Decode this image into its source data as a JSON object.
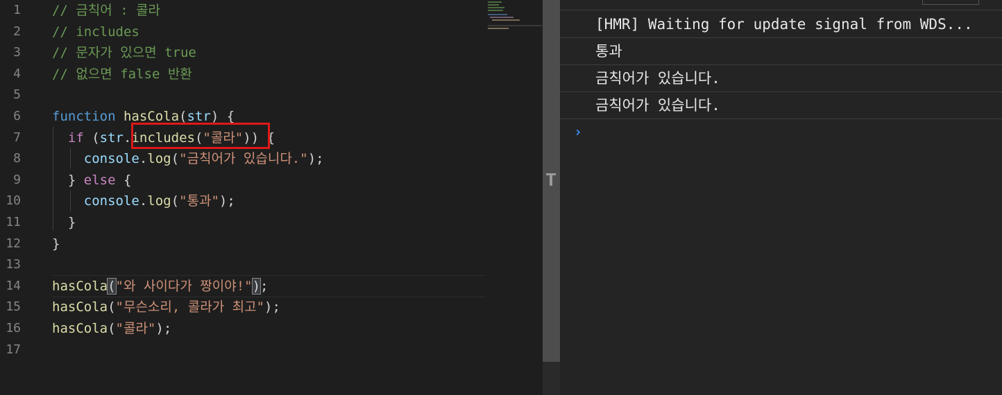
{
  "editor": {
    "lines": [
      {
        "num": "1",
        "tokens": [
          {
            "text": "// 금칙어 : 콜라",
            "type": "comment"
          }
        ]
      },
      {
        "num": "2",
        "tokens": [
          {
            "text": "// includes",
            "type": "comment"
          }
        ]
      },
      {
        "num": "3",
        "tokens": [
          {
            "text": "// 문자가 있으면 true",
            "type": "comment"
          }
        ]
      },
      {
        "num": "4",
        "tokens": [
          {
            "text": "// 없으면 false 반환",
            "type": "comment"
          }
        ]
      },
      {
        "num": "5",
        "tokens": []
      },
      {
        "num": "6",
        "tokens": [
          {
            "text": "function",
            "type": "kw"
          },
          {
            "text": " ",
            "type": "punc"
          },
          {
            "text": "hasCola",
            "type": "fn"
          },
          {
            "text": "(",
            "type": "punc"
          },
          {
            "text": "str",
            "type": "var"
          },
          {
            "text": ") {",
            "type": "punc"
          }
        ]
      },
      {
        "num": "7",
        "tokens": [
          {
            "text": "  if",
            "type": "ctrl"
          },
          {
            "text": " (",
            "type": "punc"
          },
          {
            "text": "str",
            "type": "var"
          },
          {
            "text": ".",
            "type": "punc"
          },
          {
            "text": "includes",
            "type": "fn"
          },
          {
            "text": "(",
            "type": "punc"
          },
          {
            "text": "\"콜라\"",
            "type": "str"
          },
          {
            "text": ")) {",
            "type": "punc"
          }
        ]
      },
      {
        "num": "8",
        "tokens": [
          {
            "text": "    console",
            "type": "var"
          },
          {
            "text": ".",
            "type": "punc"
          },
          {
            "text": "log",
            "type": "fn"
          },
          {
            "text": "(",
            "type": "punc"
          },
          {
            "text": "\"금칙어가 있습니다.\"",
            "type": "str"
          },
          {
            "text": ");",
            "type": "punc"
          }
        ]
      },
      {
        "num": "9",
        "tokens": [
          {
            "text": "  } ",
            "type": "punc"
          },
          {
            "text": "else",
            "type": "ctrl"
          },
          {
            "text": " {",
            "type": "punc"
          }
        ]
      },
      {
        "num": "10",
        "tokens": [
          {
            "text": "    console",
            "type": "var"
          },
          {
            "text": ".",
            "type": "punc"
          },
          {
            "text": "log",
            "type": "fn"
          },
          {
            "text": "(",
            "type": "punc"
          },
          {
            "text": "\"통과\"",
            "type": "str"
          },
          {
            "text": ");",
            "type": "punc"
          }
        ]
      },
      {
        "num": "11",
        "tokens": [
          {
            "text": "  }",
            "type": "punc"
          }
        ]
      },
      {
        "num": "12",
        "tokens": [
          {
            "text": "}",
            "type": "punc"
          }
        ]
      },
      {
        "num": "13",
        "tokens": []
      },
      {
        "num": "14",
        "tokens": [
          {
            "text": "hasCola",
            "type": "fn"
          },
          {
            "text": "(",
            "type": "punc",
            "bracket": true
          },
          {
            "text": "\"와 사이다가 짱이야!\"",
            "type": "str"
          },
          {
            "text": ")",
            "type": "punc",
            "bracket": true
          },
          {
            "text": ";",
            "type": "punc"
          }
        ]
      },
      {
        "num": "15",
        "tokens": [
          {
            "text": "hasCola",
            "type": "fn"
          },
          {
            "text": "(",
            "type": "punc"
          },
          {
            "text": "\"무슨소리, 콜라가 최고\"",
            "type": "str"
          },
          {
            "text": ");",
            "type": "punc"
          }
        ]
      },
      {
        "num": "16",
        "tokens": [
          {
            "text": "hasCola",
            "type": "fn"
          },
          {
            "text": "(",
            "type": "punc"
          },
          {
            "text": "\"콜라\"",
            "type": "str"
          },
          {
            "text": ");",
            "type": "punc"
          }
        ]
      },
      {
        "num": "17",
        "tokens": []
      }
    ]
  },
  "console": {
    "messages": [
      "[HMR] Waiting for update signal from WDS...",
      "통과",
      "금칙어가 있습니다.",
      "금칙어가 있습니다."
    ],
    "prompt_icon": "chevron-right-icon"
  },
  "colors": {
    "highlight_box": "#e01818",
    "comment": "#6a9955",
    "keyword": "#569cd6",
    "control": "#c586c0",
    "function": "#dcdcaa",
    "variable": "#9cdcfe",
    "string": "#ce9178",
    "prompt": "#3a8ef5"
  }
}
